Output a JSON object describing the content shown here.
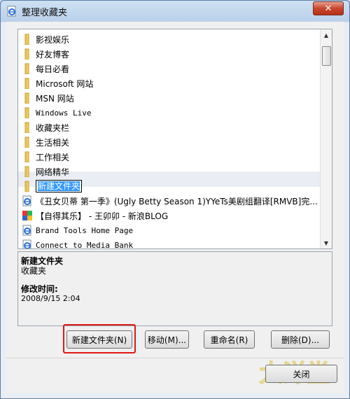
{
  "window": {
    "title": "整理收藏夹",
    "close_glyph": "✕"
  },
  "list": {
    "items": [
      {
        "type": "folder",
        "label": "影视娱乐"
      },
      {
        "type": "folder",
        "label": "好友博客"
      },
      {
        "type": "folder",
        "label": "每日必看"
      },
      {
        "type": "folder",
        "label": "Microsoft 网站"
      },
      {
        "type": "folder",
        "label": "MSN 网站"
      },
      {
        "type": "folder",
        "label": "Windows Live"
      },
      {
        "type": "folder",
        "label": "收藏夹栏"
      },
      {
        "type": "folder",
        "label": "生活相关"
      },
      {
        "type": "folder",
        "label": "工作相关"
      },
      {
        "type": "folder",
        "label": "网络精华"
      },
      {
        "type": "folder-editing",
        "label": "新建文件夹"
      },
      {
        "type": "page",
        "label": "《丑女贝蒂 第一季》(Ugly Betty Season 1)YYeTs美剧组翻译[RMVB]完..."
      },
      {
        "type": "page-colorful",
        "label": "【自得其乐】 - 王卯卯 - 新浪BLOG"
      },
      {
        "type": "page",
        "label": "Brand Tools Home Page"
      },
      {
        "type": "page",
        "label": "Connect to Media Bank"
      }
    ]
  },
  "details": {
    "name": "新建文件夹",
    "type": "收藏夹",
    "modified_label": "修改时间:",
    "modified_value": "2008/9/15 2:04"
  },
  "buttons": {
    "new_folder": "新建文件夹(N)",
    "move": "移动(M)...",
    "rename": "重命名(R)",
    "delete": "删除(D)...",
    "close": "关闭"
  },
  "watermark_text": "大洋堂",
  "colors": {
    "highlight": "#e01818",
    "selection": "#3399ff",
    "folder": "#e8c35a"
  }
}
